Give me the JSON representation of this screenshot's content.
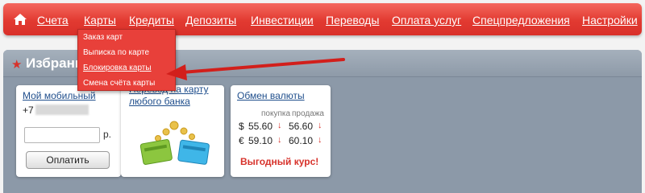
{
  "nav": {
    "items": [
      "Счета",
      "Карты",
      "Кредиты",
      "Депозиты",
      "Инвестиции",
      "Переводы",
      "Оплата услуг",
      "Спецпредложения",
      "Настройки"
    ]
  },
  "dropdown": {
    "items": [
      "Заказ карт",
      "Выписка по карте",
      "Блокировка карты",
      "Смена счёта карты"
    ],
    "highlighted": "Блокировка карты"
  },
  "favorites": {
    "title": "Избранное",
    "mobile": {
      "title": "Мой мобильный",
      "phone_prefix": "+7",
      "amount_value": "",
      "currency": "р.",
      "pay_label": "Оплатить"
    },
    "transfer": {
      "title_line1": "Перевод на карту",
      "title_line2": "любого банка"
    },
    "exchange": {
      "title": "Обмен валюты",
      "buy_label": "покупка",
      "sell_label": "продажа",
      "usd": {
        "symbol": "$",
        "buy": "55.60",
        "sell": "56.60"
      },
      "eur": {
        "symbol": "€",
        "buy": "59.10",
        "sell": "60.10"
      },
      "promo": "Выгодный курс!"
    }
  },
  "colors": {
    "brand_red": "#e23a31",
    "link_blue": "#1f4e8c",
    "panel_gray": "#8c99a8"
  }
}
